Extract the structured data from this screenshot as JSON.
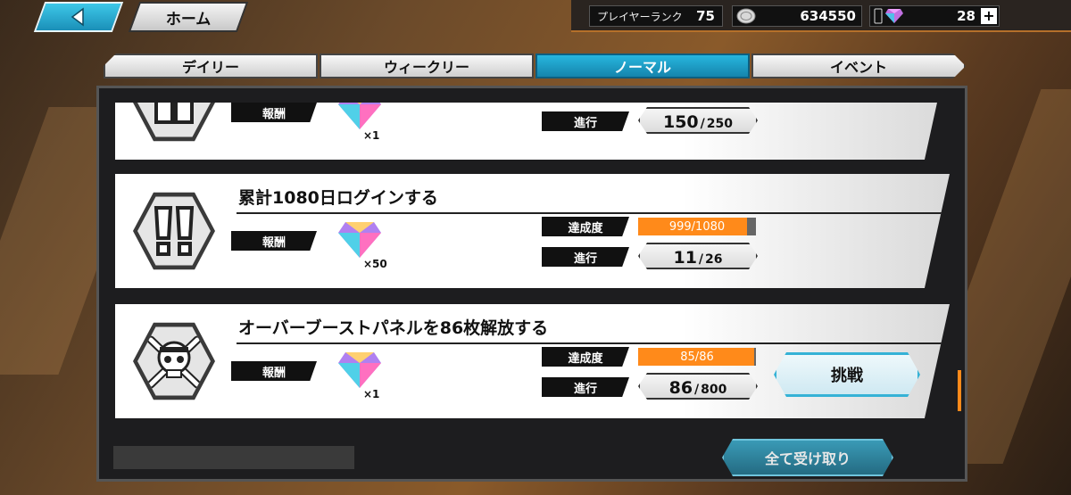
{
  "header": {
    "home_label": "ホーム",
    "player_rank_label": "プレイヤーランク",
    "player_rank": "75",
    "coins": "634550",
    "gems": "28"
  },
  "tabs": [
    {
      "label": "デイリー",
      "active": false
    },
    {
      "label": "ウィークリー",
      "active": false
    },
    {
      "label": "ノーマル",
      "active": true
    },
    {
      "label": "イベント",
      "active": false
    }
  ],
  "missions": [
    {
      "title": "",
      "reward_label": "報酬",
      "reward_count": "×1",
      "progress_label": "進行",
      "progress_current": "150",
      "progress_max": "250"
    },
    {
      "title": "累計1080日ログインする",
      "reward_label": "報酬",
      "reward_count": "×50",
      "achievement_label": "達成度",
      "achievement": "999/1080",
      "achievement_fraction": 0.925,
      "progress_label": "進行",
      "progress_current": "11",
      "progress_max": "26"
    },
    {
      "title": "オーバーブーストパネルを86枚解放する",
      "reward_label": "報酬",
      "reward_count": "×1",
      "achievement_label": "達成度",
      "achievement": "85/86",
      "achievement_fraction": 0.988,
      "progress_label": "進行",
      "progress_current": "86",
      "progress_max": "800",
      "challenge_label": "挑戦"
    }
  ],
  "footer": {
    "claim_all_label": "全て受け取り"
  },
  "colors": {
    "accent": "#27b6de",
    "progress": "#ff8a1a"
  }
}
